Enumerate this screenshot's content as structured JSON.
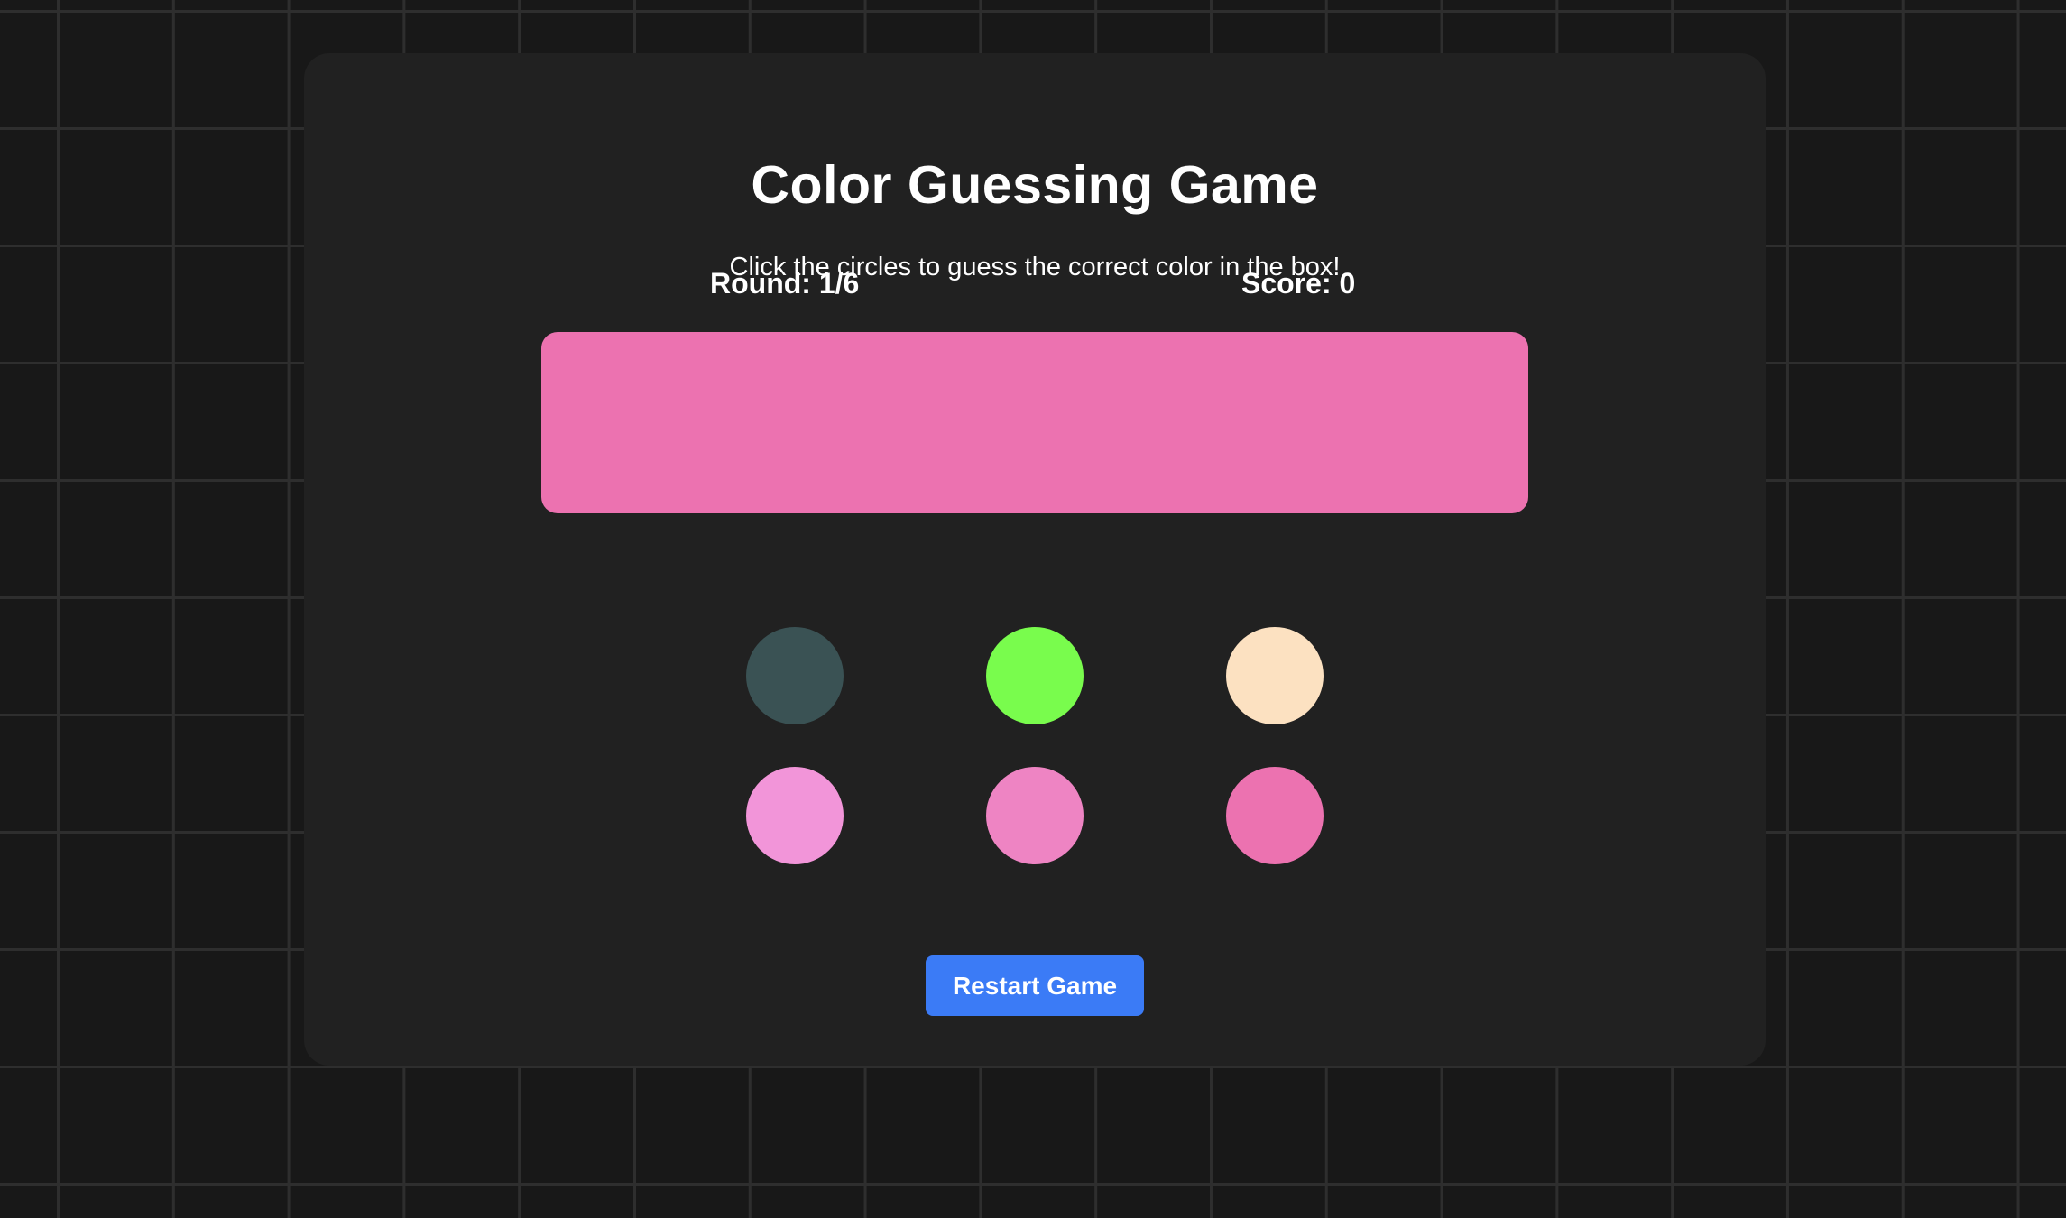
{
  "game": {
    "title": "Color Guessing Game",
    "instructions": "Click the circles to guess the correct color in the box!",
    "round_label": "Round: 1/6",
    "score_label": "Score: 0",
    "target_color": "#ec72b0",
    "options": [
      {
        "name": "option-dark-slate",
        "color": "#3a5254"
      },
      {
        "name": "option-lime-green",
        "color": "#79fc4d"
      },
      {
        "name": "option-peach",
        "color": "#fce1c1"
      },
      {
        "name": "option-light-pink",
        "color": "#f295d9"
      },
      {
        "name": "option-medium-pink",
        "color": "#ee84c3"
      },
      {
        "name": "option-pink",
        "color": "#ec72b0"
      }
    ],
    "restart_label": "Restart Game"
  },
  "colors": {
    "background": "#181818",
    "card": "#212121",
    "grid_line": "#2e2e2e",
    "accent": "#3b7bf6",
    "text": "#ffffff"
  }
}
